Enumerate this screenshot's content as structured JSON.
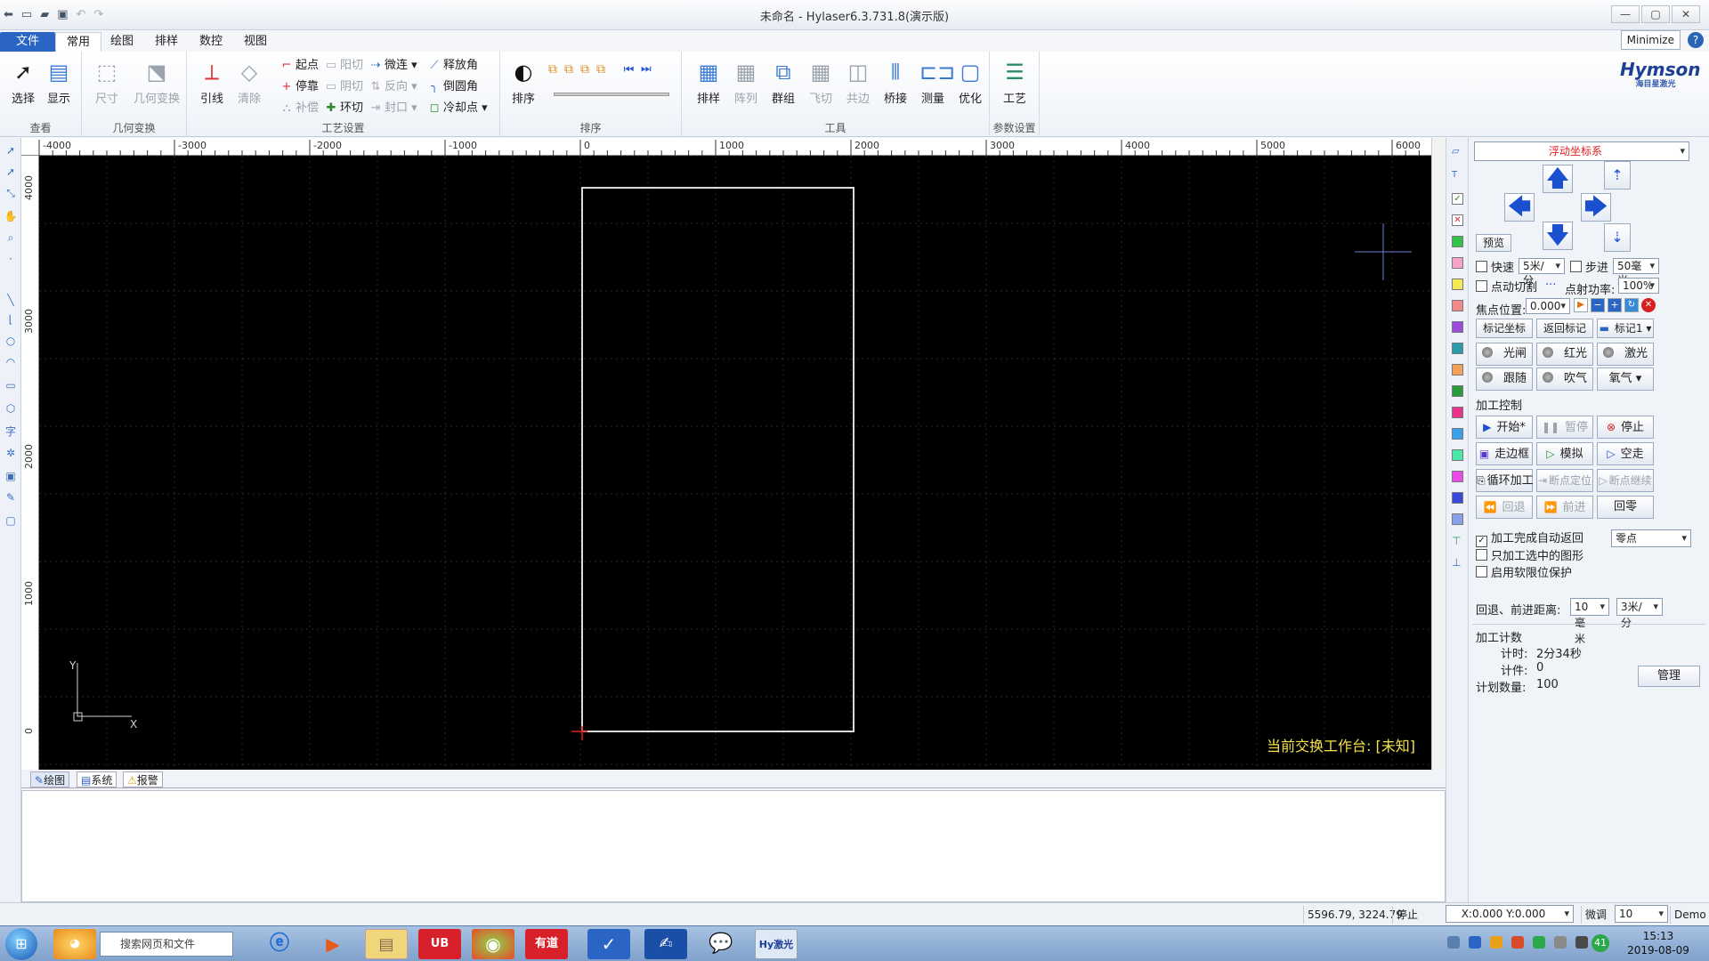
{
  "window": {
    "title": "未命名 - Hylaser6.3.731.8(演示版)",
    "min_btn": "—",
    "max_btn": "▢",
    "close_btn": "✕",
    "minimize_label": "Minimize",
    "help": "?"
  },
  "tabs": [
    {
      "label": "文件"
    },
    {
      "label": "常用"
    },
    {
      "label": "绘图"
    },
    {
      "label": "排样"
    },
    {
      "label": "数控"
    },
    {
      "label": "视图"
    }
  ],
  "ribbon": {
    "groups": {
      "view": "查看",
      "geo": "几何变换",
      "craft": "工艺设置",
      "sort": "排序",
      "tools": "工具",
      "params": "参数设置"
    },
    "select": "选择",
    "display": "显示",
    "size": "尺寸",
    "geotrans": "几何变换",
    "lead": "引线",
    "clear": "清除",
    "startpt": "起点",
    "stoppt": "停靠",
    "comp": "补偿",
    "yangqie": "阳切",
    "yinqie": "阴切",
    "huanqie": "环切",
    "weilian": "微连",
    "fanxiang": "反向",
    "fengkou": "封口",
    "shifangjiao": "释放角",
    "daoyuanjiao": "倒圆角",
    "lengquedian": "冷却点",
    "paixu": "排序",
    "paiyang": "排样",
    "zhenlie": "阵列",
    "qunzu": "群组",
    "feiqie": "飞切",
    "gongbian": "共边",
    "qiaojie": "桥接",
    "celiang": "测量",
    "youhua": "优化",
    "gongyi": "工艺"
  },
  "logo": {
    "brand": "Hymson",
    "sub": "海目星激光"
  },
  "rulers": {
    "top": [
      "-4000",
      "-3000",
      "-2000",
      "-1000",
      "0",
      "1000",
      "2000",
      "3000",
      "4000",
      "5000",
      "6000"
    ],
    "left": [
      "4000",
      "3000",
      "2000",
      "1000",
      "0"
    ]
  },
  "canvas": {
    "axis_y": "Y",
    "axis_x": "X",
    "status_text": "当前交换工作台: [未知]"
  },
  "panel": {
    "coord_system": "浮动坐标系",
    "preview": "预览",
    "fast": "快速",
    "fast_speed": "5米/分",
    "step": "步进",
    "step_val": "50毫米",
    "pulse_cut": "点动切割",
    "pulse_more": "···",
    "pulse_power": "点射功率:",
    "pulse_power_val": "100%",
    "focus": "焦点位置:",
    "focus_val": "0.000",
    "mark_coord": "标记坐标",
    "back_mark": "返回标记",
    "mark1": "标记1",
    "shutter": "光闸",
    "red": "红光",
    "laser": "激光",
    "follow": "跟随",
    "blow": "吹气",
    "oxygen": "氧气",
    "process_ctrl": "加工控制",
    "start": "开始*",
    "pause": "暂停",
    "stop": "停止",
    "frame": "走边框",
    "simulate": "模拟",
    "dryrun": "空走",
    "loop": "循环加工",
    "bp_locate": "断点定位",
    "bp_continue": "断点继续",
    "back": "回退",
    "forward": "前进",
    "home": "回零",
    "auto_return": "加工完成自动返回",
    "return_target": "零点",
    "only_selected": "只加工选中的图形",
    "soft_limit": "启用软限位保护",
    "distance_label": "回退、前进距离:",
    "distance_val": "10毫米",
    "distance_speed": "3米/分",
    "count_title": "加工计数",
    "timer_label": "计时:",
    "timer_val": "2分34秒",
    "pieces_label": "计件:",
    "pieces_val": "0",
    "plan_label": "计划数量:",
    "plan_val": "100",
    "manage": "管理"
  },
  "bottom_tabs": [
    {
      "label": "绘图"
    },
    {
      "label": "系统"
    },
    {
      "label": "报警"
    }
  ],
  "status": {
    "coords": "5596.79, 3224.79",
    "state": "停止",
    "xy": "X:0.000 Y:0.000",
    "fine": "微调",
    "fine_val": "10",
    "mode": "Demo"
  },
  "taskbar": {
    "search_placeholder": "搜索网页和文件",
    "time": "15:13",
    "date": "2019-08-09",
    "badge": "41",
    "apps": [
      "UB",
      "有道",
      "Hy激光"
    ]
  },
  "colors": {
    "accent": "#2a65c5",
    "canvas": "#000000",
    "status_yellow": "#f5e14a",
    "arrow_blue": "#1a4fd0"
  }
}
